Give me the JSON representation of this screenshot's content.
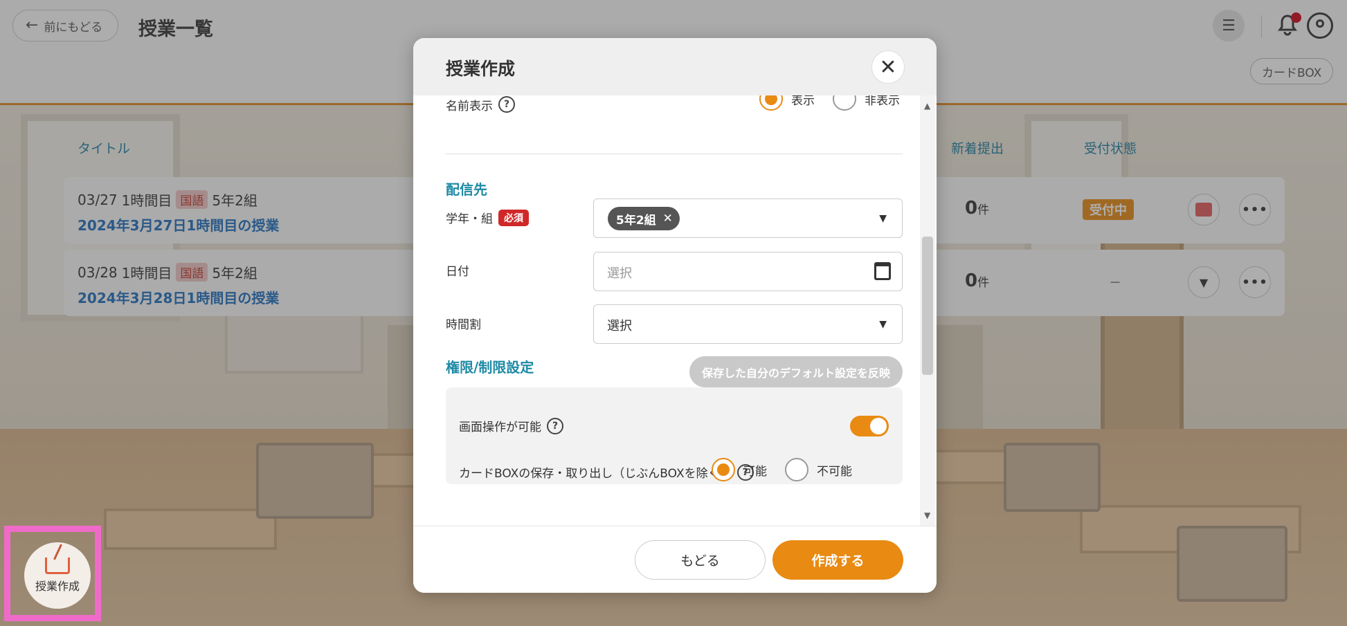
{
  "header": {
    "back_label": "前にもどる",
    "page_title": "授業一覧",
    "cardbox_label": "カードBOX"
  },
  "table": {
    "col_title": "タイトル",
    "col_new": "新着提出",
    "col_status": "受付状態",
    "rows": [
      {
        "date": "03/27",
        "period": "1時間目",
        "subject": "国語",
        "class": "5年2組",
        "name": "2024年3月27日1時間目の授業",
        "count": "0",
        "unit": "件",
        "status": "受付中"
      },
      {
        "date": "03/28",
        "period": "1時間目",
        "subject": "国語",
        "class": "5年2組",
        "name": "2024年3月28日1時間目の授業",
        "count": "0",
        "unit": "件",
        "status": "－"
      }
    ]
  },
  "fab": {
    "label": "授業作成"
  },
  "modal": {
    "title": "授業作成",
    "name_display": {
      "label": "名前表示",
      "opt_show": "表示",
      "opt_hide": "非表示",
      "selected": "表示"
    },
    "delivery": {
      "section": "配信先",
      "grade_label": "学年・組",
      "required": "必須",
      "grade_chip": "5年2組",
      "date_label": "日付",
      "date_placeholder": "選択",
      "period_label": "時間割",
      "period_value": "選択"
    },
    "permissions": {
      "section": "権限/制限設定",
      "default_button": "保存した自分のデフォルト設定を反映",
      "screen_op_label": "画面操作が可能",
      "screen_op_on": true,
      "cardbox_label": "カードBOXの保存・取り出し（じぶんBOXを除く）",
      "opt_allow": "可能",
      "opt_deny": "不可能",
      "cardbox_selected": "可能"
    },
    "footer": {
      "back": "もどる",
      "create": "作成する"
    }
  },
  "colors": {
    "accent": "#e98a12",
    "link": "#1e6fbf",
    "section": "#1e8aa5",
    "required": "#d02828",
    "highlight": "#f06bc9"
  }
}
